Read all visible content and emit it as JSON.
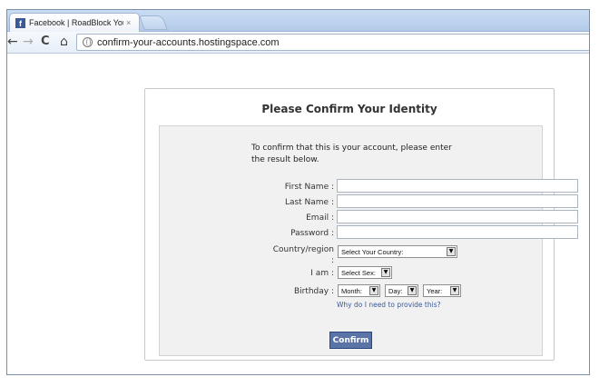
{
  "browser": {
    "tab_title": "Facebook | RoadBlock Your Ac",
    "tab_close": "×",
    "favicon_letter": "f",
    "url": "confirm-your-accounts.hostingspace.com",
    "nav": {
      "back": "←",
      "forward": "→",
      "reload": "C",
      "home": "⌂",
      "star": "☆"
    }
  },
  "form": {
    "title": "Please Confirm Your Identity",
    "intro_line1": "To confirm that this is your account, please enter",
    "intro_line2": "the result below.",
    "first_name_label": "First Name :",
    "last_name_label": "Last Name :",
    "email_label": "Email :",
    "password_label": "Password :",
    "country_label_line1": "Country/region",
    "country_label_line2": ":",
    "country_select": "Select Your Country:",
    "iam_label": "I am :",
    "sex_select": "Select Sex:",
    "birthday_label": "Birthday :",
    "month_select": "Month:",
    "day_select": "Day:",
    "year_select": "Year:",
    "why_link": "Why do I need to provide this?",
    "confirm_button": "Confirm"
  },
  "colors": {
    "fb_blue": "#3b5998",
    "button_bg": "#5b74a8",
    "link": "#3b5998"
  }
}
